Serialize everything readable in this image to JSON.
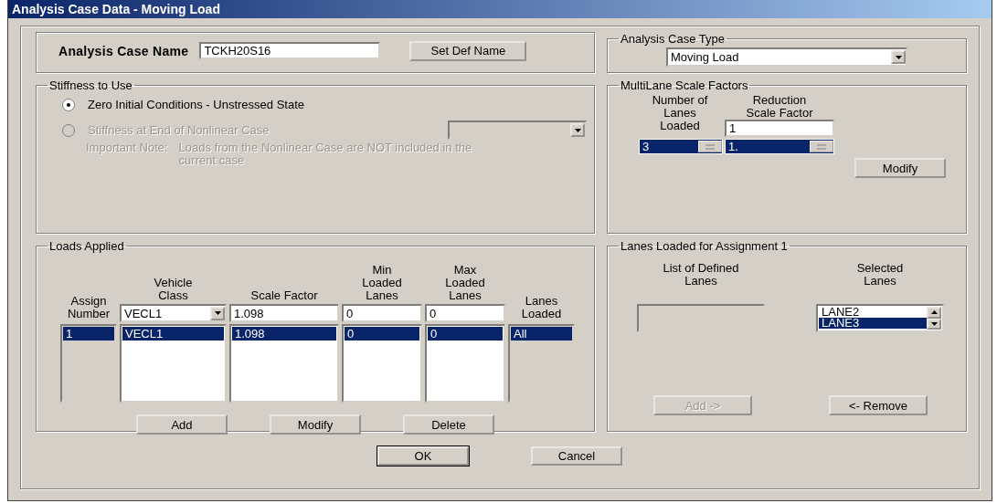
{
  "window": {
    "title": "Analysis Case Data - Moving Load"
  },
  "case_name": {
    "label": "Analysis Case Name",
    "value": "TCKH20S16",
    "button": "Set Def Name"
  },
  "case_type": {
    "title": "Analysis Case Type",
    "value": "Moving Load"
  },
  "stiffness": {
    "title": "Stiffness to Use",
    "options": [
      {
        "label": "Zero Initial Conditions - Unstressed State",
        "selected": true,
        "disabled": false
      },
      {
        "label": "Stiffness at End of Nonlinear Case",
        "selected": false,
        "disabled": true
      }
    ],
    "case_dropdown": {
      "disabled": true
    },
    "note_label": "Important Note:",
    "note": "Loads from the Nonlinear Case are NOT included in the current case"
  },
  "multilane": {
    "title": "MultiLane Scale Factors",
    "columns": [
      "Number of\nLanes\nLoaded",
      "Reduction\nScale Factor"
    ],
    "factor_input": "1",
    "rows": [
      {
        "cells": [
          "3",
          "1."
        ],
        "selected": true
      }
    ],
    "button": "Modify"
  },
  "loads": {
    "title": "Loads Applied",
    "columns": [
      {
        "header": "Assign\nNumber",
        "kind": "plain"
      },
      {
        "header": "Vehicle\nClass",
        "input": "VECL1",
        "kind": "dropdown"
      },
      {
        "header": "Scale Factor",
        "input": "1.098",
        "kind": "text"
      },
      {
        "header": "Min\nLoaded\nLanes",
        "input": "0",
        "kind": "text"
      },
      {
        "header": "Max\nLoaded\nLanes",
        "input": "0",
        "kind": "text"
      },
      {
        "header": "Lanes\nLoaded",
        "kind": "plain"
      }
    ],
    "rows": [
      {
        "cells": [
          "1",
          "VECL1",
          "1.098",
          "0",
          "0",
          "All"
        ],
        "selected": true
      }
    ],
    "buttons": [
      "Add",
      "Modify",
      "Delete"
    ]
  },
  "lanes": {
    "title": "Lanes Loaded for Assignment 1",
    "defined_title": "List of Defined\nLanes",
    "selected_title": "Selected\nLanes",
    "selected_lanes": [
      {
        "label": "LANE2",
        "selected": false
      },
      {
        "label": "LANE3",
        "selected": true
      }
    ],
    "buttons": [
      {
        "label": "Add ->",
        "disabled": true
      },
      {
        "label": "<- Remove",
        "disabled": false
      }
    ]
  },
  "footer": {
    "buttons": [
      {
        "label": "OK",
        "default": true
      },
      {
        "label": "Cancel",
        "default": false
      }
    ]
  }
}
